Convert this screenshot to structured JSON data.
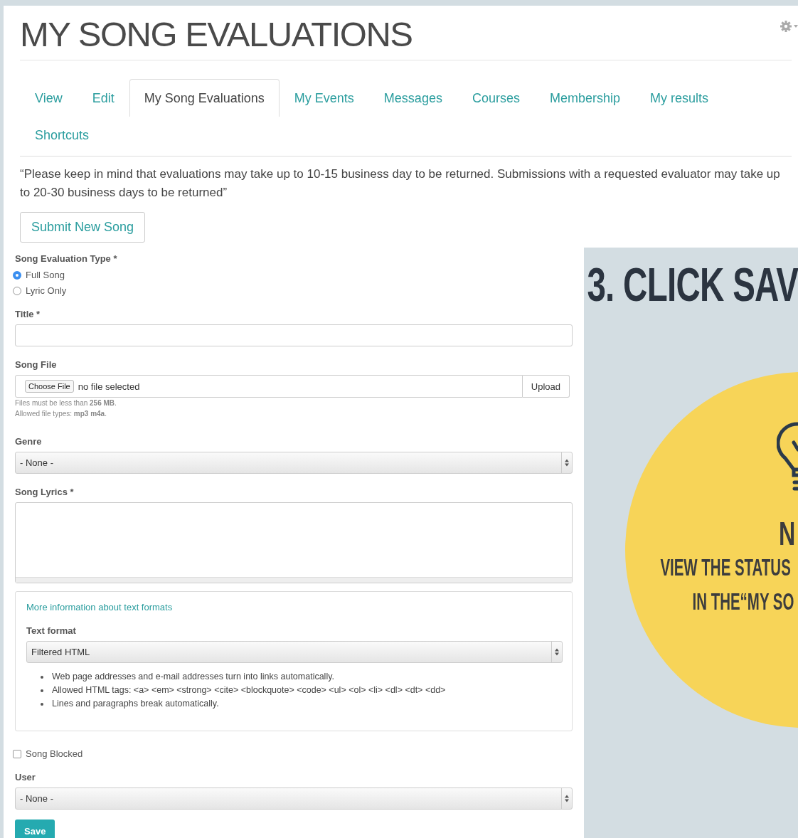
{
  "page_title": "MY SONG EVALUATIONS",
  "tabs": [
    {
      "label": "View",
      "selected": false
    },
    {
      "label": "Edit",
      "selected": false
    },
    {
      "label": "My Song Evaluations",
      "selected": true
    },
    {
      "label": "My Events",
      "selected": false
    },
    {
      "label": "Messages",
      "selected": false
    },
    {
      "label": "Courses",
      "selected": false
    },
    {
      "label": "Membership",
      "selected": false
    },
    {
      "label": "My results",
      "selected": false
    },
    {
      "label": "Shortcuts",
      "selected": false
    }
  ],
  "notice": "“Please keep in mind that evaluations may take up to 10-15 business day to be returned. Submissions with a requested evaluator may take up to 20-30 business days to be returned”",
  "submit_button": "Submit New Song",
  "form": {
    "evaluation_type": {
      "label": "Song Evaluation Type *",
      "options": [
        {
          "label": "Full Song",
          "selected": true
        },
        {
          "label": "Lyric Only",
          "selected": false
        }
      ]
    },
    "title_field": {
      "label": "Title *"
    },
    "song_file": {
      "label": "Song File",
      "choose_button": "Choose File",
      "status": "no file selected",
      "upload_button": "Upload",
      "help": [
        "Files must be less than **256 MB**.",
        "Allowed file types: **mp3 m4a**."
      ]
    },
    "genre": {
      "label": "Genre",
      "value": "- None -"
    },
    "lyrics": {
      "label": "Song Lyrics *"
    },
    "text_format": {
      "link": "More information about text formats",
      "label": "Text format",
      "value": "Filtered HTML",
      "tips": [
        "Web page addresses and e-mail addresses turn into links automatically.",
        "Allowed HTML tags: <a> <em> <strong> <cite> <blockquote> <code> <ul> <ol> <li> <dl> <dt> <dd>",
        "Lines and paragraphs break automatically."
      ]
    },
    "song_blocked": {
      "label": "Song Blocked",
      "checked": false
    },
    "user": {
      "label": "User",
      "value": "- None -"
    },
    "save_button": "Save"
  },
  "overlay": {
    "heading": "3. CLICK SAV",
    "note_title": "N",
    "note_lines": [
      "VIEW THE STATUS",
      "IN THE“MY SO"
    ]
  }
}
